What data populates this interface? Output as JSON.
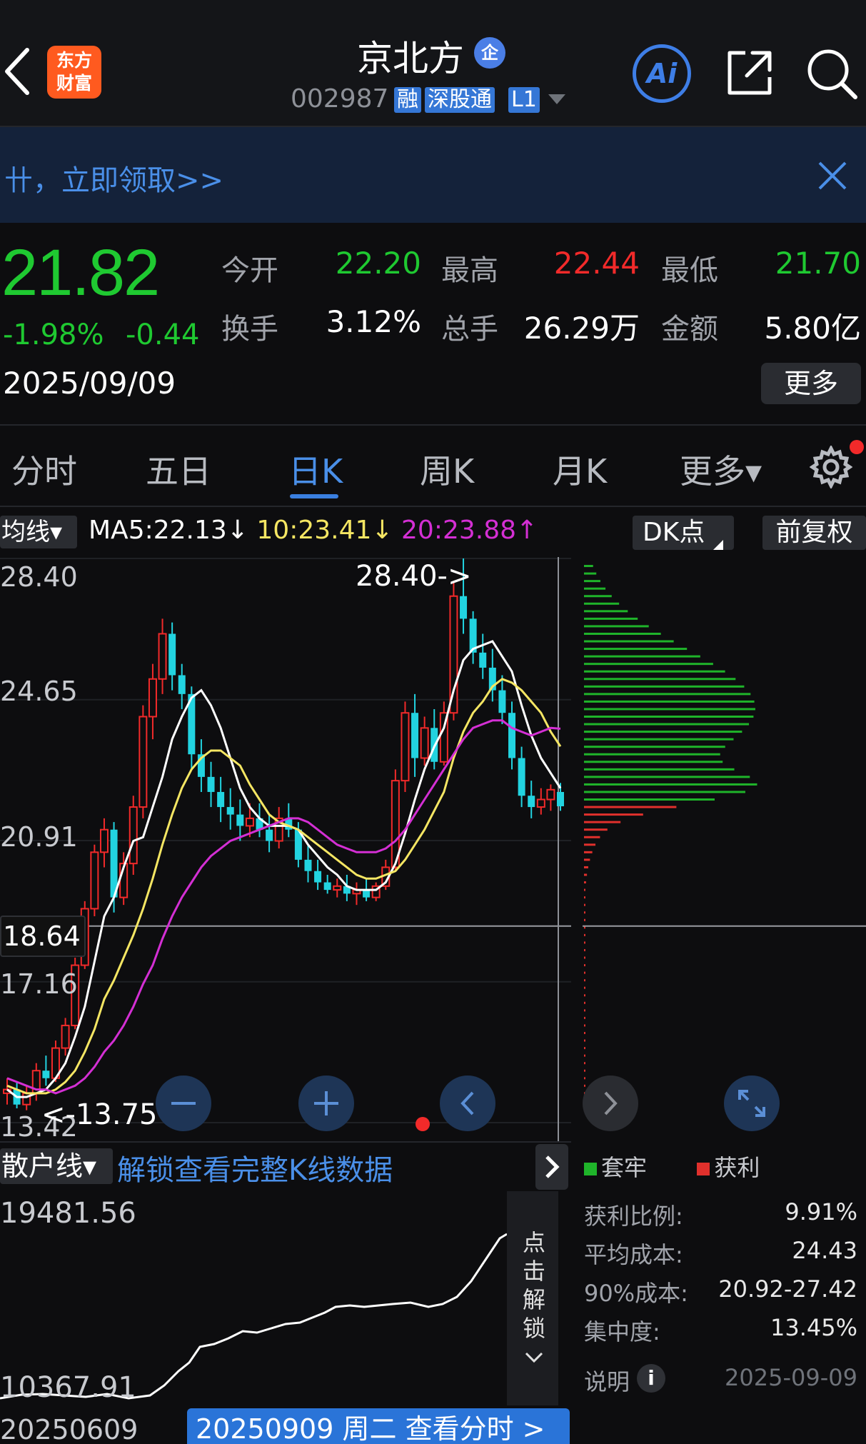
{
  "header": {
    "logo_line1": "东方",
    "logo_line2": "财富",
    "stock_name": "京北方",
    "qi_badge": "企",
    "stock_code": "002987",
    "tags": [
      "融",
      "深股通",
      "L1"
    ],
    "ai_label": "Ai",
    "icons": [
      "back-icon",
      "share-icon",
      "search-icon"
    ]
  },
  "banner": {
    "text": "卄，立即领取>>",
    "close_icon": "close-icon"
  },
  "quote": {
    "price": "21.82",
    "change_pct": "-1.98%",
    "change": "-0.44",
    "date": "2025/09/09",
    "open_label": "今开",
    "open": "22.20",
    "high_label": "最高",
    "high": "22.44",
    "low_label": "最低",
    "low": "21.70",
    "turnover_label": "换手",
    "turnover": "3.12%",
    "volume_label": "总手",
    "volume": "26.29万",
    "amount_label": "金额",
    "amount": "5.80亿",
    "more_label": "更多",
    "colors": {
      "down": "#1fc931",
      "up": "#f22a2a"
    }
  },
  "tabs": [
    "分时",
    "五日",
    "日K",
    "周K",
    "月K",
    "更多▾"
  ],
  "active_tab": "日K",
  "ma_row": {
    "select_label": "均线▾",
    "ma5": "MA5:22.13↓",
    "ma10": "10:23.41↓",
    "ma20": "20:23.88↑",
    "dk_label": "DK点",
    "fq_label": "前复权",
    "colors": {
      "ma5": "#ffffff",
      "ma10": "#f5e663",
      "ma20": "#d42fd4"
    }
  },
  "kchart": {
    "y_labels": [
      "28.40",
      "24.65",
      "20.91",
      "17.16",
      "13.42"
    ],
    "crosshair_price": "18.64",
    "high_annotation": "28.40->",
    "low_annotation": "<-13.75",
    "controls": [
      "minus-icon",
      "plus-icon",
      "chevron-left-icon",
      "chevron-right-icon",
      "expand-icon"
    ]
  },
  "chart_data": {
    "type": "candlestick",
    "ylim": [
      13.42,
      28.4
    ],
    "candles": [
      [
        14.2,
        14.6,
        13.9,
        14.3
      ],
      [
        14.3,
        14.5,
        13.8,
        13.9
      ],
      [
        13.9,
        14.4,
        13.75,
        14.2
      ],
      [
        14.2,
        15.0,
        14.0,
        14.8
      ],
      [
        14.8,
        15.2,
        14.4,
        14.6
      ],
      [
        14.6,
        15.6,
        14.5,
        15.4
      ],
      [
        15.4,
        16.2,
        15.2,
        16.0
      ],
      [
        16.0,
        17.8,
        15.9,
        17.6
      ],
      [
        17.6,
        19.3,
        17.5,
        19.1
      ],
      [
        19.1,
        20.8,
        18.9,
        20.6
      ],
      [
        20.6,
        21.5,
        20.2,
        21.2
      ],
      [
        21.2,
        21.4,
        19.0,
        19.4
      ],
      [
        19.4,
        20.6,
        19.2,
        20.3
      ],
      [
        20.3,
        22.1,
        20.0,
        21.8
      ],
      [
        21.8,
        24.5,
        21.5,
        24.2
      ],
      [
        24.2,
        25.6,
        23.6,
        25.2
      ],
      [
        25.2,
        26.8,
        24.8,
        26.4
      ],
      [
        26.4,
        26.7,
        24.9,
        25.3
      ],
      [
        25.3,
        25.6,
        24.4,
        24.8
      ],
      [
        24.8,
        25.0,
        22.8,
        23.2
      ],
      [
        23.2,
        23.6,
        22.2,
        22.6
      ],
      [
        22.6,
        23.0,
        21.8,
        22.2
      ],
      [
        22.2,
        22.6,
        21.4,
        21.8
      ],
      [
        21.8,
        22.3,
        21.2,
        21.6
      ],
      [
        21.6,
        22.0,
        20.9,
        21.3
      ],
      [
        21.3,
        21.9,
        21.0,
        21.5
      ],
      [
        21.5,
        21.9,
        21.0,
        21.2
      ],
      [
        21.2,
        21.6,
        20.6,
        20.9
      ],
      [
        20.9,
        21.8,
        20.7,
        21.5
      ],
      [
        21.5,
        21.9,
        21.0,
        21.2
      ],
      [
        21.2,
        21.4,
        20.2,
        20.4
      ],
      [
        20.4,
        20.8,
        19.8,
        20.1
      ],
      [
        20.1,
        20.4,
        19.6,
        19.8
      ],
      [
        19.8,
        20.0,
        19.5,
        19.6
      ],
      [
        19.6,
        19.9,
        19.4,
        19.7
      ],
      [
        19.7,
        20.0,
        19.3,
        19.5
      ],
      [
        19.5,
        19.8,
        19.2,
        19.6
      ],
      [
        19.6,
        19.9,
        19.3,
        19.4
      ],
      [
        19.4,
        19.8,
        19.3,
        19.7
      ],
      [
        19.7,
        20.4,
        19.6,
        20.2
      ],
      [
        20.2,
        22.8,
        20.1,
        22.5
      ],
      [
        22.5,
        24.6,
        22.2,
        24.3
      ],
      [
        24.3,
        24.8,
        22.6,
        23.1
      ],
      [
        23.1,
        24.2,
        22.9,
        23.9
      ],
      [
        23.9,
        24.4,
        22.8,
        23.0
      ],
      [
        23.0,
        24.6,
        22.9,
        24.3
      ],
      [
        24.3,
        27.8,
        24.1,
        27.4
      ],
      [
        27.4,
        28.4,
        26.4,
        26.8
      ],
      [
        26.8,
        27.0,
        25.6,
        25.9
      ],
      [
        25.9,
        26.4,
        25.2,
        25.5
      ],
      [
        25.5,
        26.0,
        24.6,
        24.9
      ],
      [
        24.9,
        25.3,
        24.0,
        24.3
      ],
      [
        24.3,
        24.6,
        22.8,
        23.1
      ],
      [
        23.1,
        23.4,
        21.8,
        22.1
      ],
      [
        22.1,
        22.5,
        21.5,
        21.8
      ],
      [
        21.8,
        22.3,
        21.6,
        22.0
      ],
      [
        22.0,
        22.4,
        21.7,
        22.26
      ],
      [
        22.2,
        22.44,
        21.7,
        21.82
      ]
    ],
    "series": [
      {
        "name": "MA5",
        "color": "#ffffff",
        "values": [
          14.3,
          14.1,
          14.1,
          14.2,
          14.3,
          14.6,
          15.0,
          15.7,
          16.5,
          17.7,
          18.9,
          19.4,
          20.2,
          20.9,
          21.0,
          21.8,
          22.6,
          23.6,
          24.2,
          24.7,
          24.9,
          24.5,
          23.9,
          23.1,
          22.3,
          21.8,
          21.5,
          21.3,
          21.3,
          21.3,
          21.2,
          20.8,
          20.5,
          20.2,
          20.0,
          19.7,
          19.6,
          19.6,
          19.6,
          19.8,
          20.3,
          21.1,
          22.0,
          22.8,
          23.4,
          23.9,
          24.9,
          25.7,
          26.0,
          26.1,
          26.2,
          25.8,
          25.4,
          24.5,
          23.7,
          23.1,
          22.7,
          22.3
        ]
      },
      {
        "name": "MA10",
        "color": "#f5e663",
        "values": [
          14.4,
          14.3,
          14.2,
          14.2,
          14.2,
          14.3,
          14.5,
          14.8,
          15.3,
          15.9,
          16.7,
          17.2,
          17.8,
          18.4,
          19.1,
          19.9,
          20.8,
          21.6,
          22.3,
          22.8,
          23.1,
          23.3,
          23.3,
          23.1,
          22.9,
          22.4,
          22.0,
          21.6,
          21.4,
          21.3,
          21.2,
          21.0,
          20.8,
          20.6,
          20.4,
          20.2,
          20.0,
          19.9,
          19.9,
          20.0,
          20.1,
          20.4,
          20.8,
          21.2,
          21.7,
          22.2,
          23.1,
          23.8,
          24.3,
          24.6,
          25.0,
          25.2,
          25.1,
          24.9,
          24.6,
          24.3,
          23.8,
          23.41
        ]
      },
      {
        "name": "MA20",
        "color": "#d42fd4",
        "values": [
          14.6,
          14.5,
          14.4,
          14.3,
          14.3,
          14.2,
          14.3,
          14.4,
          14.6,
          14.9,
          15.3,
          15.6,
          16.0,
          16.5,
          17.1,
          17.6,
          18.3,
          18.9,
          19.4,
          19.8,
          20.2,
          20.5,
          20.7,
          20.9,
          21.0,
          21.1,
          21.2,
          21.3,
          21.4,
          21.5,
          21.5,
          21.4,
          21.2,
          21.0,
          20.8,
          20.7,
          20.6,
          20.6,
          20.6,
          20.7,
          20.9,
          21.2,
          21.6,
          22.0,
          22.4,
          22.8,
          23.2,
          23.6,
          23.9,
          24.0,
          24.1,
          24.1,
          23.9,
          23.8,
          23.7,
          23.8,
          23.9,
          23.88
        ]
      }
    ],
    "chip_distribution": {
      "legend": [
        "套牢",
        "获利"
      ],
      "colors": {
        "trapped": "#1fb42a",
        "profit": "#e0302c"
      }
    }
  },
  "lower": {
    "select_label": "散户线▾",
    "unlock_text": "解锁查看完整K线数据",
    "y_max": "19481.56",
    "y_min": "10367.91",
    "lock_text": [
      "点",
      "击",
      "解",
      "锁"
    ],
    "date_start": "20250609",
    "date_box": "20250909 周二 查看分时 >"
  },
  "chip_info": {
    "legend_trapped": "套牢",
    "legend_profit": "获利",
    "rows": [
      {
        "label": "获利比例:",
        "value": "9.91%"
      },
      {
        "label": "平均成本:",
        "value": "24.43"
      },
      {
        "label": "90%成本:",
        "value": "20.92-27.42"
      },
      {
        "label": "集中度:",
        "value": "13.45%"
      }
    ],
    "note_label": "说明",
    "note_date": "2025-09-09"
  }
}
